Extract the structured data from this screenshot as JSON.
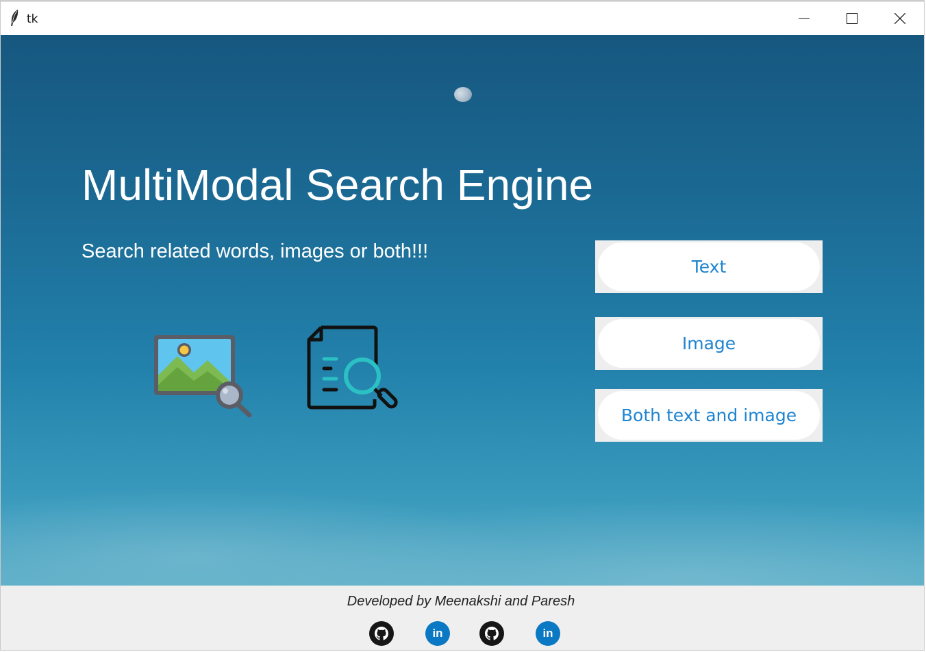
{
  "window": {
    "title": "tk"
  },
  "hero": {
    "title": "MultiModal Search Engine",
    "subtitle": "Search related words, images or both!!!"
  },
  "icons": {
    "image_search": "image-search-icon",
    "document_search": "document-search-icon"
  },
  "search_modes": [
    {
      "label": "Text"
    },
    {
      "label": "Image"
    },
    {
      "label": "Both text and image"
    }
  ],
  "footer": {
    "credit": "Developed by Meenakshi and Paresh",
    "links": [
      {
        "icon": "github-icon",
        "glyph": ""
      },
      {
        "icon": "linkedin-icon",
        "glyph": "in"
      },
      {
        "icon": "github-icon",
        "glyph": ""
      },
      {
        "icon": "linkedin-icon",
        "glyph": "in"
      }
    ]
  },
  "colors": {
    "button_text": "#1e84d0",
    "sky_top": "#16577f",
    "sky_bottom": "#5aaec7",
    "linkedin": "#0a78c2",
    "github": "#161616"
  }
}
